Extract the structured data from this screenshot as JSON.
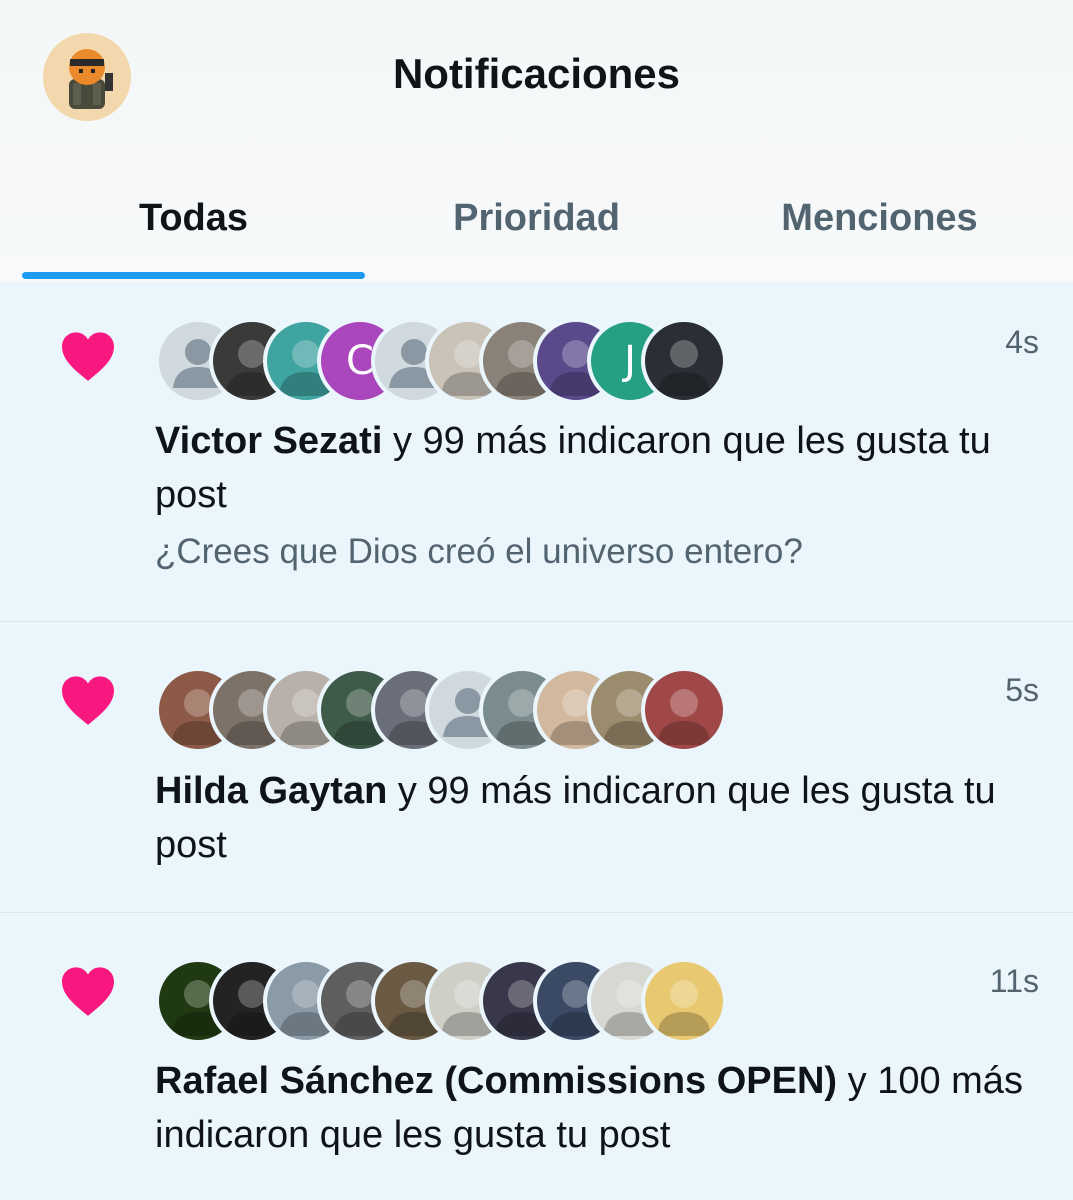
{
  "header": {
    "title": "Notificaciones",
    "avatar_icon": "profile-avatar-icon"
  },
  "tabs": [
    {
      "label": "Todas",
      "active": true
    },
    {
      "label": "Prioridad",
      "active": false
    },
    {
      "label": "Menciones",
      "active": false
    }
  ],
  "colors": {
    "accent": "#1d9bf0",
    "heart": "#f91880",
    "unread_bg": "#ebf6fc",
    "secondary_text": "#536471"
  },
  "notifications": [
    {
      "type": "like",
      "icon": "heart-icon",
      "time": "4s",
      "name": "Victor Sezati",
      "rest": " y 99 más indicaron que les gusta tu post",
      "snippet": "¿Crees que Dios creó el universo entero?",
      "avatars": [
        {
          "kind": "default",
          "letter": "",
          "color": "#cfd9de"
        },
        {
          "kind": "photo",
          "letter": "",
          "color": "#3a3a38"
        },
        {
          "kind": "photo",
          "letter": "",
          "color": "#3fa3a0"
        },
        {
          "kind": "letter",
          "letter": "C",
          "color": "#ab47bc"
        },
        {
          "kind": "default",
          "letter": "",
          "color": "#cfd9de"
        },
        {
          "kind": "photo",
          "letter": "",
          "color": "#c9c3b8"
        },
        {
          "kind": "photo",
          "letter": "",
          "color": "#8a8178"
        },
        {
          "kind": "photo",
          "letter": "",
          "color": "#5a4a8c"
        },
        {
          "kind": "letter",
          "letter": "J",
          "color": "#26a085"
        },
        {
          "kind": "photo",
          "letter": "",
          "color": "#2b2f35"
        }
      ]
    },
    {
      "type": "like",
      "icon": "heart-icon",
      "time": "5s",
      "name": "Hilda Gaytan",
      "rest": " y 99 más indicaron que les gusta tu post",
      "snippet": "",
      "avatars": [
        {
          "kind": "photo",
          "letter": "",
          "color": "#8c5a46"
        },
        {
          "kind": "photo",
          "letter": "",
          "color": "#7d7268"
        },
        {
          "kind": "photo",
          "letter": "",
          "color": "#b8b0aa"
        },
        {
          "kind": "photo",
          "letter": "",
          "color": "#3e5a48"
        },
        {
          "kind": "photo",
          "letter": "",
          "color": "#6a6e78"
        },
        {
          "kind": "default",
          "letter": "",
          "color": "#cfd9de"
        },
        {
          "kind": "photo",
          "letter": "",
          "color": "#7a8c8e"
        },
        {
          "kind": "photo",
          "letter": "",
          "color": "#d2b89e"
        },
        {
          "kind": "photo",
          "letter": "",
          "color": "#9c8c6e"
        },
        {
          "kind": "photo",
          "letter": "",
          "color": "#a04848"
        }
      ]
    },
    {
      "type": "like",
      "icon": "heart-icon",
      "time": "11s",
      "name": "Rafael Sánchez (Commissions OPEN)",
      "rest": " y 100 más indicaron que les gusta tu post",
      "snippet": "",
      "avatars": [
        {
          "kind": "photo",
          "letter": "",
          "color": "#1f3a12"
        },
        {
          "kind": "photo",
          "letter": "",
          "color": "#232323"
        },
        {
          "kind": "photo",
          "letter": "",
          "color": "#8a9aa6"
        },
        {
          "kind": "photo",
          "letter": "",
          "color": "#5e5e5e"
        },
        {
          "kind": "photo",
          "letter": "",
          "color": "#6a5a44"
        },
        {
          "kind": "photo",
          "letter": "",
          "color": "#cfcfc8"
        },
        {
          "kind": "photo",
          "letter": "",
          "color": "#38384a"
        },
        {
          "kind": "photo",
          "letter": "",
          "color": "#3a4a64"
        },
        {
          "kind": "photo",
          "letter": "",
          "color": "#d8d8d2"
        },
        {
          "kind": "photo",
          "letter": "",
          "color": "#e8c870"
        }
      ]
    }
  ]
}
